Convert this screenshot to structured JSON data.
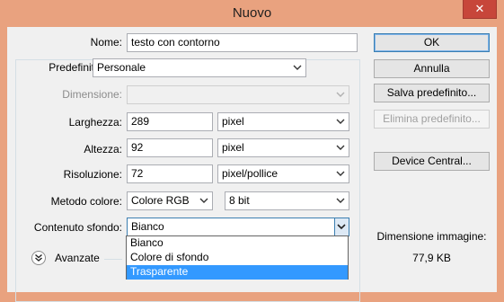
{
  "window": {
    "title": "Nuovo",
    "close_glyph": "✕"
  },
  "form": {
    "name": {
      "label": "Nome:",
      "value": "testo con contorno"
    },
    "preset": {
      "label": "Predefinito:",
      "value": "Personale"
    },
    "size": {
      "label": "Dimensione:",
      "value": ""
    },
    "width": {
      "label": "Larghezza:",
      "value": "289",
      "unit": "pixel"
    },
    "height": {
      "label": "Altezza:",
      "value": "92",
      "unit": "pixel"
    },
    "resolution": {
      "label": "Risoluzione:",
      "value": "72",
      "unit": "pixel/pollice"
    },
    "color_mode": {
      "label": "Metodo colore:",
      "value": "Colore RGB",
      "depth": "8 bit"
    },
    "background": {
      "label": "Contenuto sfondo:",
      "value": "Bianco",
      "options": [
        "Bianco",
        "Colore di sfondo",
        "Trasparente"
      ],
      "highlighted": "Trasparente"
    },
    "advanced": {
      "label": "Avanzate",
      "icon": "double-chevron-down-icon"
    }
  },
  "buttons": {
    "ok": "OK",
    "cancel": "Annulla",
    "save_preset": "Salva predefinito...",
    "delete_preset": "Elimina predefinito...",
    "device_central": "Device Central..."
  },
  "image_info": {
    "label": "Dimensione immagine:",
    "value": "77,9 KB"
  },
  "colors": {
    "frame": "#e9a27f",
    "selection": "#3399ff",
    "close": "#c7463a"
  }
}
